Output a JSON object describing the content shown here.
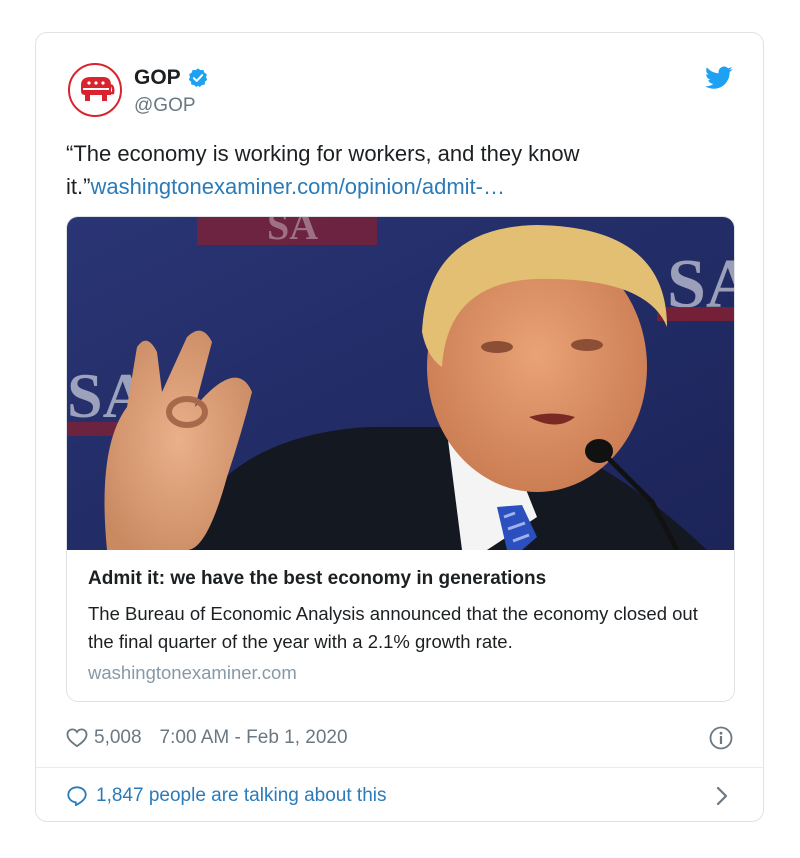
{
  "author": {
    "name": "GOP",
    "handle": "@GOP",
    "verified": true
  },
  "tweet": {
    "text_prefix": "“The economy is working for workers, and they know it.”",
    "link_text": "washingtonexaminer.com/opinion/admit-…"
  },
  "card": {
    "title": "Admit it: we have the best economy in generations",
    "description": "The Bureau of Economic Analysis announced that the economy closed out the final quarter of the year with a 2.1% growth rate.",
    "domain": "washingtonexaminer.com"
  },
  "meta": {
    "likes": "5,008",
    "timestamp": "7:00 AM - Feb 1, 2020"
  },
  "footer": {
    "talking": "1,847 people are talking about this"
  },
  "icons": {
    "avatar": "gop-elephant-icon",
    "verified": "verified-badge-icon",
    "brand": "twitter-bird-icon",
    "like": "heart-icon",
    "info": "info-icon",
    "reply": "speech-bubble-icon",
    "more": "chevron-right-icon"
  },
  "colors": {
    "link": "#2b7bb9",
    "verified": "#1da1f2",
    "gop_red": "#d9232e",
    "muted": "#697882"
  }
}
